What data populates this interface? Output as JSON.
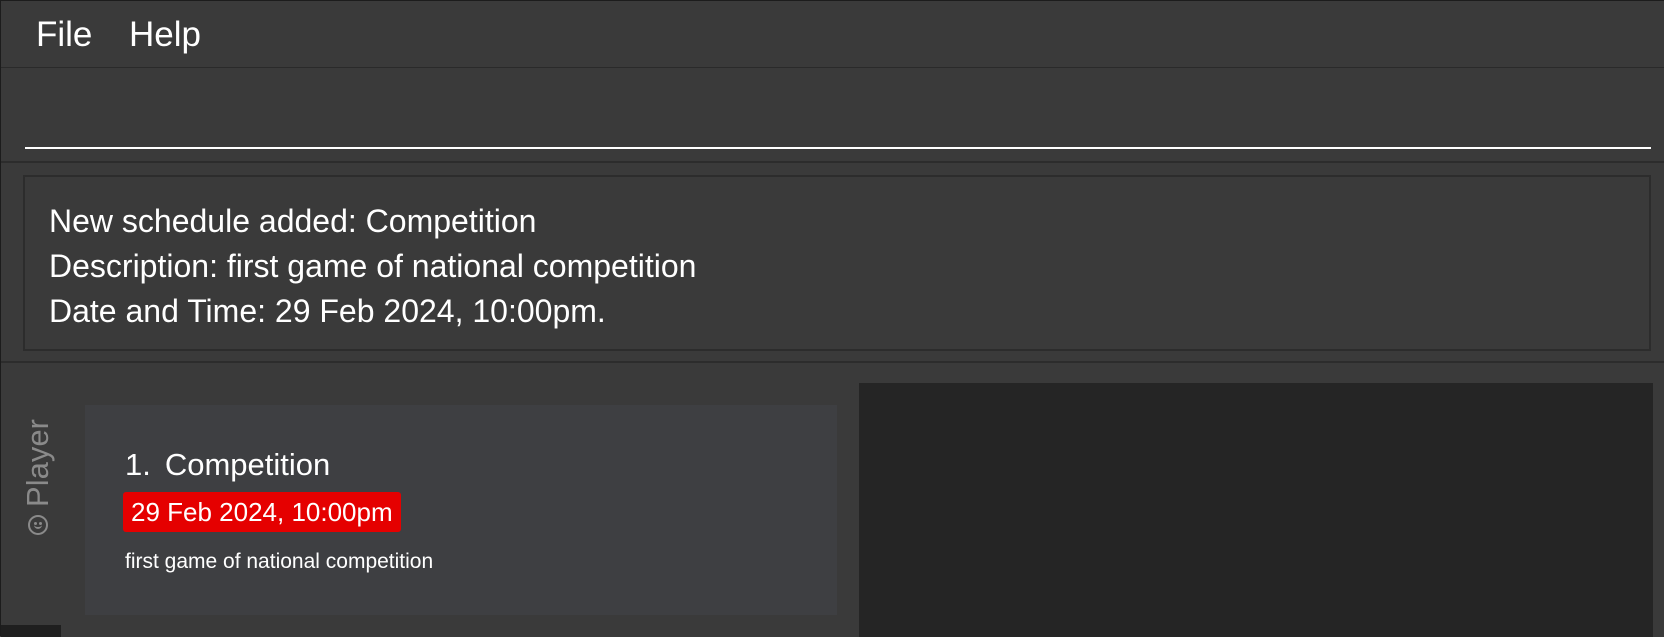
{
  "menu": {
    "file_label": "File",
    "help_label": "Help"
  },
  "command_box": {
    "value": "",
    "placeholder": ""
  },
  "result": {
    "lines": [
      "New schedule added: Competition",
      "Description: first game of national competition",
      "Date and Time: 29 Feb 2024, 10:00pm."
    ]
  },
  "tabs": {
    "player_label": "Player",
    "player_icon": "smiley-icon"
  },
  "schedule_list": {
    "items": [
      {
        "index": "1.",
        "name": "Competition",
        "datetime": "29 Feb 2024, 10:00pm",
        "description": "first game of national competition"
      }
    ]
  },
  "colors": {
    "background": "#3a3a3a",
    "card": "#3e3f42",
    "datetime_badge": "#e50000",
    "detail_panel": "#252525",
    "tab_text": "#8a8a8a"
  }
}
